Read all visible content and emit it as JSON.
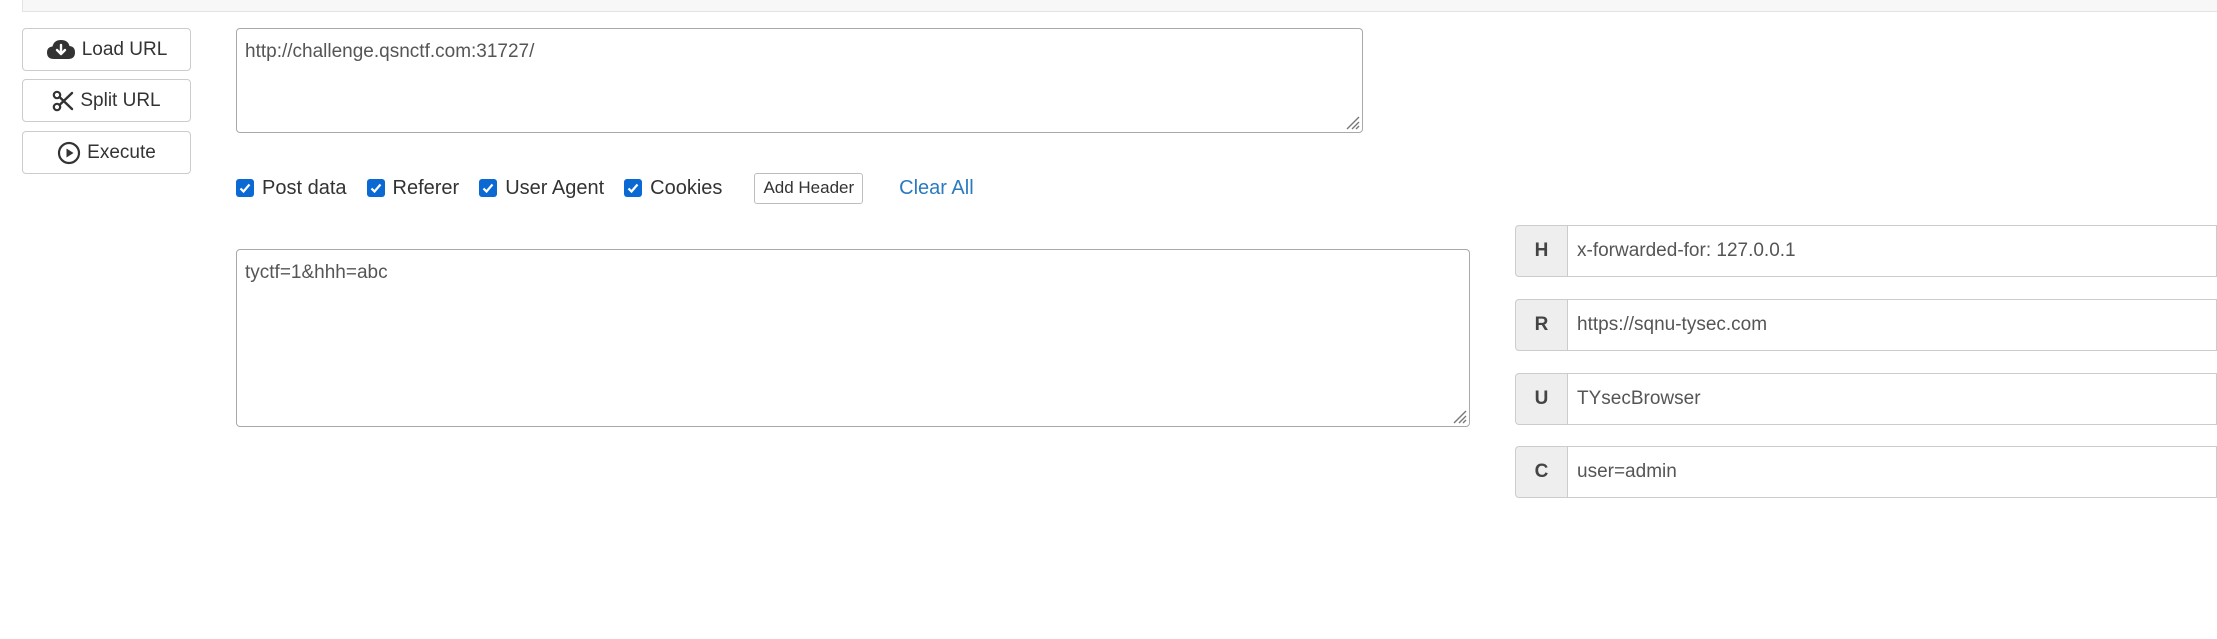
{
  "sidebar": {
    "load_url": "Load URL",
    "split_url": "Split URL",
    "execute": "Execute"
  },
  "url_field": {
    "value": "http://challenge.qsnctf.com:31727/"
  },
  "options": {
    "post_data": {
      "label": "Post data",
      "checked": true
    },
    "referer": {
      "label": "Referer",
      "checked": true
    },
    "user_agent": {
      "label": "User Agent",
      "checked": true
    },
    "cookies": {
      "label": "Cookies",
      "checked": true
    },
    "add_header": "Add Header",
    "clear_all": "Clear All"
  },
  "post_field": {
    "value": "tyctf=1&hhh=abc"
  },
  "headers": [
    {
      "key": "H",
      "value": "x-forwarded-for: 127.0.0.1"
    },
    {
      "key": "R",
      "value": "https://sqnu-tysec.com"
    },
    {
      "key": "U",
      "value": "TYsecBrowser"
    },
    {
      "key": "C",
      "value": "user=admin"
    }
  ],
  "colors": {
    "checkbox": "#0b69d4",
    "link": "#2a7ac0"
  }
}
